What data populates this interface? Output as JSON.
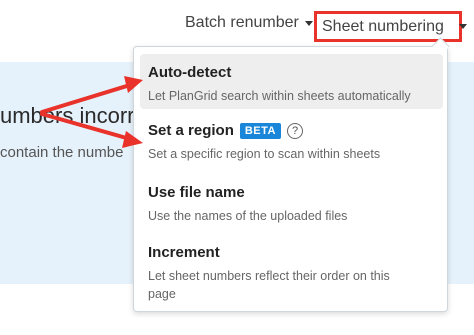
{
  "toolbar": {
    "batch_label": "Batch renumber",
    "sheet_numbering_label": "Sheet numbering"
  },
  "background": {
    "heading_fragment": "umbers incorr",
    "subtext_fragment": "contain the numbe"
  },
  "menu": {
    "items": [
      {
        "title": "Auto-detect",
        "description": "Let PlanGrid search within sheets automatically"
      },
      {
        "title": "Set a region",
        "badge": "BETA",
        "help": "?",
        "description": "Set a specific region to scan within sheets"
      },
      {
        "title": "Use file name",
        "description": "Use the names of the uploaded files"
      },
      {
        "title": "Increment",
        "description": "Let sheet numbers reflect their order on this page"
      }
    ]
  },
  "colors": {
    "annotation_red": "#e8322a",
    "badge_blue": "#1a86d9",
    "panel_blue": "#e6f2fb"
  }
}
